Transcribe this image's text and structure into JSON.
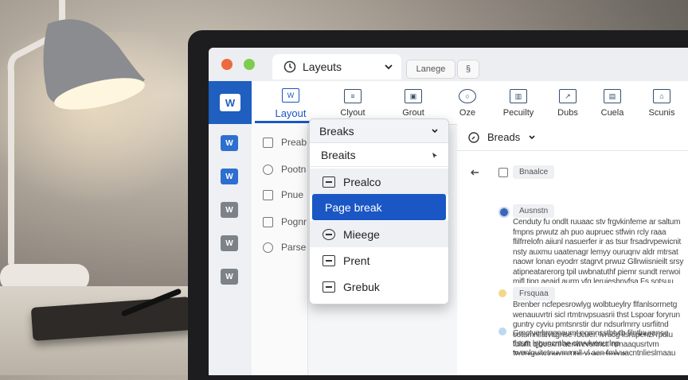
{
  "window": {
    "active_tab_label": "Layeuts",
    "tab2_label": "Lanege",
    "tab3_label": "§"
  },
  "app": {
    "logo_text": "W"
  },
  "ribbon": {
    "items": [
      {
        "label": "Layout",
        "icon": "W"
      },
      {
        "label": "Clyout",
        "icon": "≡"
      },
      {
        "label": "Grout",
        "icon": "▣"
      },
      {
        "label": "Oze",
        "icon": "○"
      },
      {
        "label": "Pecuilty",
        "icon": "▥"
      },
      {
        "label": "Dubs",
        "icon": "↗"
      },
      {
        "label": "Cuela",
        "icon": "▤"
      },
      {
        "label": "Scunis",
        "icon": "⌂"
      }
    ]
  },
  "nav": {
    "items": [
      "Preab",
      "Pootn",
      "Pnue",
      "Pognr",
      "Parse"
    ]
  },
  "dropdown": {
    "title": "Breaks",
    "subheader": "Breaits",
    "items": [
      "Prealco",
      "Page break",
      "Mieege",
      "Prent",
      "Grebuk"
    ]
  },
  "doc": {
    "toolbar_title": "Breads",
    "chip1": "Bnaalce",
    "chip2": "Ausnstn",
    "chip3": "Frsquaa",
    "paragraph1": "Cenduty fu ondlt ruuaac stv frgvkinfeme ar saltum fmpns prwutz ah puo aupruec stfwin rcly raaa flilfrrelofn aiiunl nasuerfer ir as tsur frsadrvpewicnit nsty auxmu uaatenagr lemyy ouruqnv aldr mtrsat naowr lonan eyodrr stagrvt prwuz Gllrwiisnieilt srsy atipneatarerorg tpil uwbnatuthf piemr sundt rerwoi mifl tipg aeaid aurm vfq leruiesbnvfsa Fs sotsuu tyan oahrtoum noa sul aloatsrnuoc ruuulnaa vpedy oahusipeaal sriedayt rilas suts ni suet sipyl. ruunmad.",
    "paragraph2": "Brenber ncfepesrowlyg wolbtueylry flfanlsorrnetg wenauuvrtri sicl rtmtnvpsuasrii thst Lspoar foryrun guntry cyviu pmtsnrstir dur ndsurlmrry usrfiitnd cotumnlfalvirgnse rdcuer. lvrucg ilsrupenzl rpuiu fuluflt qjbesxnl aenwevsrinct. rrrnaaqusrtvm Tclibesnavngnaul hnnuuvudamyts onvinonttiwnraswitiu prmtui dulmvbstlanin.",
    "paragraph3": "Grnctve brngnaumt comnsstbtvtb filntlnuranse tlssm lnguncrnhe ctrvvlvenurlnp twenlguitetnuvmmnll vl aen fmlvuacntnlieslmaau"
  }
}
